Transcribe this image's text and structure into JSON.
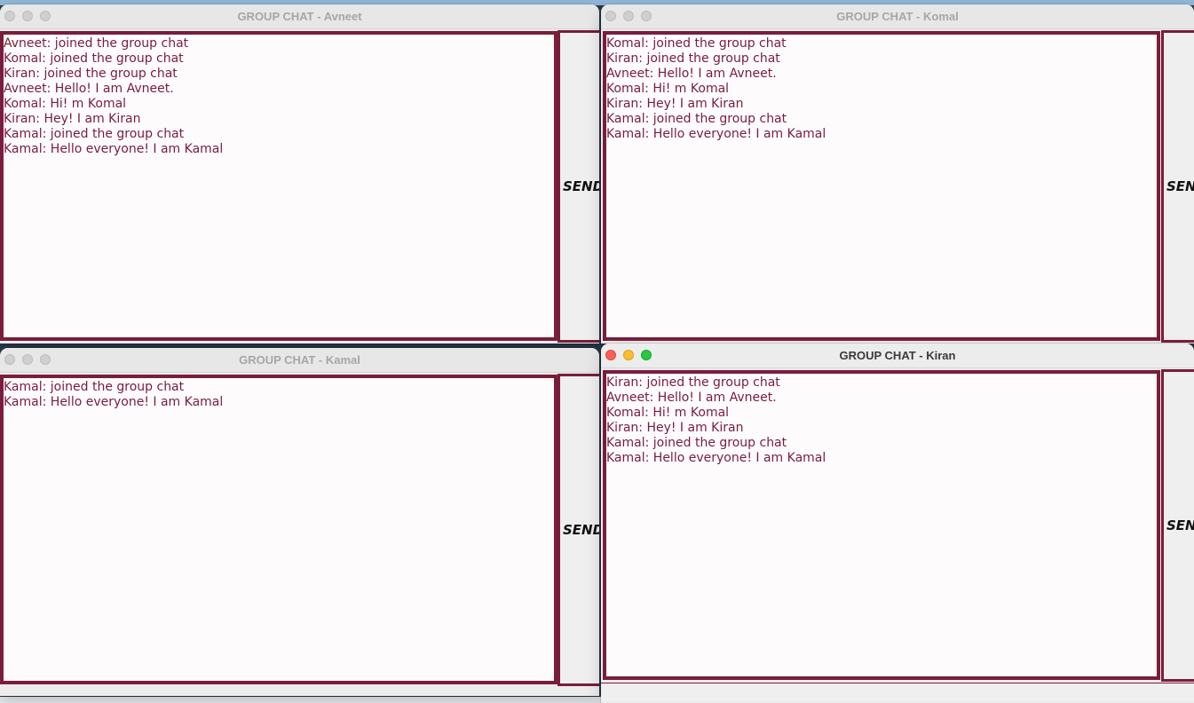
{
  "colors": {
    "accent": "#7a1d3a",
    "window_bg": "#ececec",
    "chat_bg": "#fdfbfc"
  },
  "windows": [
    {
      "title": "GROUP CHAT - Avneet",
      "active": false,
      "send_label": "SEND",
      "messages": [
        "Avneet: joined the group chat",
        "Komal: joined the group chat",
        "Kiran: joined the group chat",
        "Avneet: Hello! I am Avneet.",
        "Komal: Hi! m Komal",
        "Kiran: Hey! I am Kiran",
        "Kamal: joined the group chat",
        "Kamal: Hello everyone! I am Kamal"
      ]
    },
    {
      "title": "GROUP CHAT - Komal",
      "active": false,
      "send_label": "SEND",
      "messages": [
        "Komal: joined the group chat",
        "Kiran: joined the group chat",
        "Avneet: Hello! I am Avneet.",
        "Komal: Hi! m Komal",
        "Kiran: Hey! I am Kiran",
        "Kamal: joined the group chat",
        "Kamal: Hello everyone! I am Kamal"
      ]
    },
    {
      "title": "GROUP CHAT - Kamal",
      "active": false,
      "send_label": "SEND",
      "messages": [
        "Kamal: joined the group chat",
        "Kamal: Hello everyone! I am Kamal"
      ]
    },
    {
      "title": "GROUP CHAT - Kiran",
      "active": true,
      "send_label": "SEND",
      "messages": [
        "Kiran: joined the group chat",
        "Avneet: Hello! I am Avneet.",
        "Komal: Hi! m Komal",
        "Kiran: Hey! I am Kiran",
        "Kamal: joined the group chat",
        "Kamal: Hello everyone! I am Kamal"
      ]
    }
  ]
}
